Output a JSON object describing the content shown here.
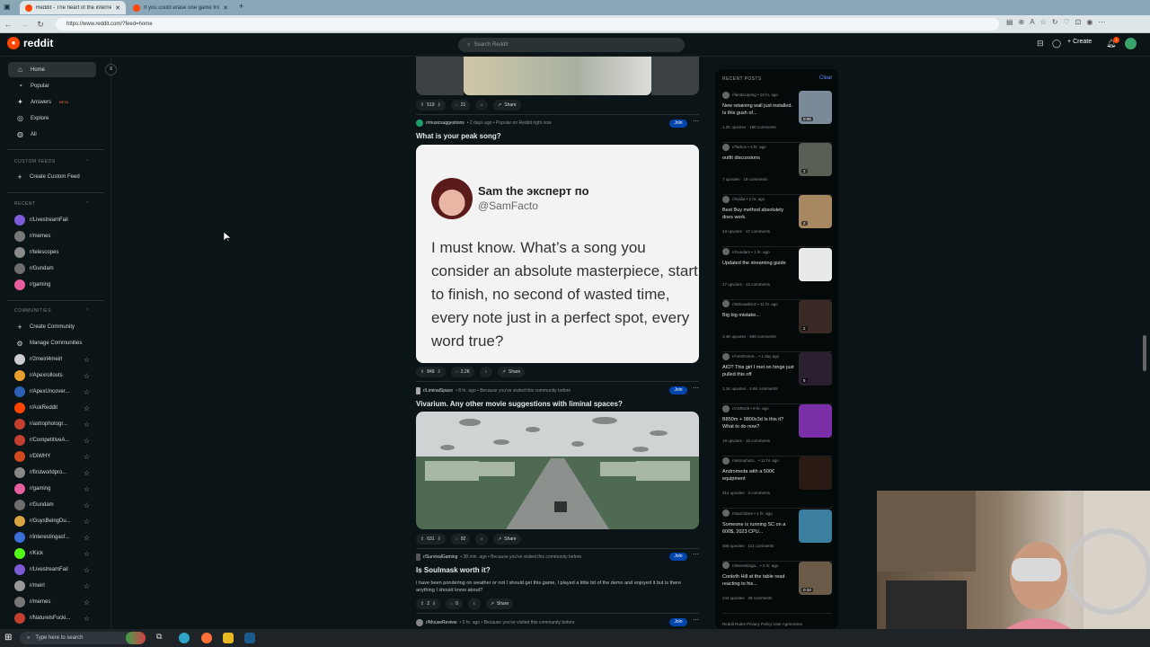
{
  "browser": {
    "tabs": [
      {
        "title": "Reddit - The heart of the internet",
        "active": true
      },
      {
        "title": "If you could erase one game from",
        "active": false
      }
    ],
    "url": "https://www.reddit.com/?feed=home"
  },
  "header": {
    "logo_text": "reddit",
    "search_placeholder": "Search Reddit",
    "create_label": "Create",
    "notification_count": "1"
  },
  "sidebar": {
    "nav": [
      {
        "label": "Home",
        "icon": "home-icon",
        "active": true
      },
      {
        "label": "Popular",
        "icon": "popular-icon"
      },
      {
        "label": "Answers",
        "icon": "answers-icon",
        "badge": "BETA"
      },
      {
        "label": "Explore",
        "icon": "explore-icon"
      },
      {
        "label": "All",
        "icon": "all-icon"
      }
    ],
    "custom_feeds_title": "CUSTOM FEEDS",
    "create_custom_feed": "Create Custom Feed",
    "recent_title": "RECENT",
    "recent": [
      {
        "name": "r/LivestreamFail",
        "color": "#7d5bd6"
      },
      {
        "name": "r/memes",
        "color": "#777777"
      },
      {
        "name": "r/telescopes",
        "color": "#8a8a8a"
      },
      {
        "name": "r/Gundam",
        "color": "#6e6e6e"
      },
      {
        "name": "r/gaming",
        "color": "#e85d9d"
      }
    ],
    "communities_title": "COMMUNITIES",
    "create_community": "Create Community",
    "manage_communities": "Manage Communities",
    "communities": [
      {
        "name": "r/2meirl4meirl",
        "color": "#cccccc"
      },
      {
        "name": "r/Apexrollouts",
        "color": "#e9a02c"
      },
      {
        "name": "r/ApexUncover...",
        "color": "#2b5fb3"
      },
      {
        "name": "r/AskReddit",
        "color": "#ff4500"
      },
      {
        "name": "r/astrophotogr...",
        "color": "#c33f2f"
      },
      {
        "name": "r/CompetitiveA...",
        "color": "#c33f2f"
      },
      {
        "name": "r/DiWHY",
        "color": "#d14a1e"
      },
      {
        "name": "r/firstworldpro...",
        "color": "#888888"
      },
      {
        "name": "r/gaming",
        "color": "#e85d9d"
      },
      {
        "name": "r/Gundam",
        "color": "#6e6e6e"
      },
      {
        "name": "r/GuysBeingDu...",
        "color": "#d9a441"
      },
      {
        "name": "r/interestingasf...",
        "color": "#3a6fd8"
      },
      {
        "name": "r/Kick",
        "color": "#53fc18"
      },
      {
        "name": "r/LivestreamFail",
        "color": "#7d5bd6"
      },
      {
        "name": "r/meirl",
        "color": "#999999"
      },
      {
        "name": "r/memes",
        "color": "#777777"
      },
      {
        "name": "r/NaturelsFucki...",
        "color": "#c33f2f"
      }
    ]
  },
  "feed": {
    "post0": {
      "votes": "519",
      "comments": "21",
      "share": "Share"
    },
    "post1": {
      "sub": "r/musicsuggestions",
      "meta": "• 2 days ago • Popular on Reddit right now",
      "title": "What is your peak song?",
      "tweet_name": "Sam the эксперт по",
      "tweet_handle": "@SamFacto",
      "tweet_text": "I must know. What’s a song you consider an absolute masterpiece, start to finish, no second of wasted time, every note just in a perfect spot, every word true?",
      "votes": "849",
      "comments": "2.2K",
      "share": "Share",
      "join": "Join"
    },
    "post2": {
      "sub": "r/LiminalSpace",
      "meta": "• 8 hr. ago • Because you've visited this community before",
      "title": "Vivarium. Any other movie suggestions with liminal spaces?",
      "votes": "631",
      "comments": "92",
      "share": "Share",
      "join": "Join"
    },
    "post3": {
      "sub": "r/SurvivalGaming",
      "meta": "• 38 min. ago • Because you've visited this community before",
      "title": "Is Soulmask worth it?",
      "body": "I have been pondering on weather or not I should get this game, I played a little bit of the demo and enjoyed it but is there anything I should know about?",
      "votes": "2",
      "comments": "0",
      "share": "Share",
      "join": "Join"
    },
    "post4": {
      "sub": "r/MouseReview",
      "meta": "• 5 hr. ago • Because you've visited this community before",
      "join": "Join"
    }
  },
  "recent_posts": {
    "title": "RECENT POSTS",
    "clear": "Clear",
    "items": [
      {
        "sub": "r/landscaping • 10 hr. ago",
        "title": "New retaining wall just installed. Is this gush of...",
        "stats": "1.2K upvotes · 190 comments",
        "thumb": "#7b8a98",
        "badge": "0:05"
      },
      {
        "sub": "r/Tarkov • 4 hr. ago",
        "title": "outfit discussions",
        "stats": "7 upvotes · 19 comments",
        "thumb": "#5a5f55",
        "badge": "2"
      },
      {
        "sub": "r/nvidia • 2 hr. ago",
        "title": "Best Buy method absolutely does work.",
        "stats": "43 upvotes · 27 comments",
        "thumb": "#a88860",
        "badge": "2"
      },
      {
        "sub": "r/Gundam • 1 hr. ago",
        "title": "Updated the streaming guide",
        "stats": "17 upvotes · 12 comments",
        "thumb": "#e9e9e9",
        "badge": ""
      },
      {
        "sub": "r/tattooadvice • 11 hr. ago",
        "title": "Big big mistake...",
        "stats": "3.4K upvotes · 556 comments",
        "thumb": "#3a2a25",
        "badge": "2"
      },
      {
        "sub": "r/AmIOverre... • 1 day ago",
        "title": "AIO? This girl I met on hinge just pulled this off",
        "stats": "1.1K upvotes · 2.6K comments",
        "thumb": "#2a2030",
        "badge": "5"
      },
      {
        "sub": "r/ASRock • 9 hr. ago",
        "title": "B850m + 9800x3d Is this it? What to do now?",
        "stats": "18 upvotes · 15 comments",
        "thumb": "#7a2ea8",
        "badge": ""
      },
      {
        "sub": "r/astrophoto... • 12 hr. ago",
        "title": "Andromeda with a 500€ equipment",
        "stats": "214 upvotes · 4 comments",
        "thumb": "#2a1a14",
        "badge": ""
      },
      {
        "sub": "r/starcitizen • 4 hr. ago",
        "title": "Someone is running SC on a 600$, 2023 CPU...",
        "stats": "499 upvotes · 111 comments",
        "thumb": "#3a7ea0",
        "badge": ""
      },
      {
        "sub": "r/interestinga... • 2 hr. ago",
        "title": "Conleth Hill at the table read reacting to his...",
        "stats": "244 upvotes · 49 comments",
        "thumb": "#6a5a48",
        "badge": "0:33"
      }
    ],
    "footer": "Reddit Rules  Privacy Policy  User Agreement"
  },
  "taskbar": {
    "search_placeholder": "Type here to search"
  }
}
